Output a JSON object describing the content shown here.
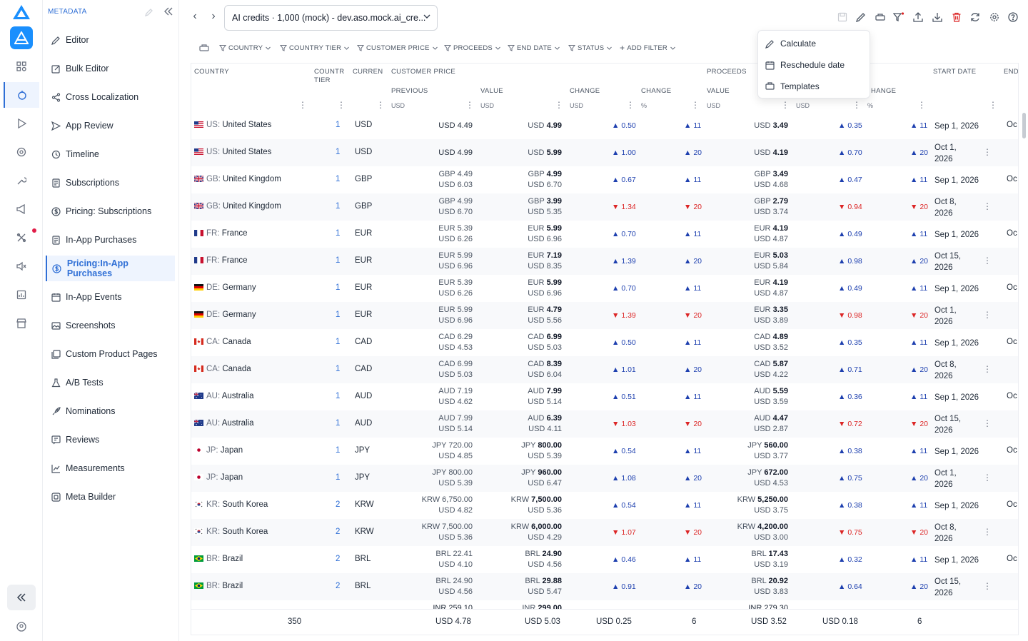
{
  "rail": {
    "items": [
      "apps-icon",
      "app-store-icon",
      "play-icon",
      "target-icon",
      "wrench-icon",
      "megaphone-icon",
      "tools-icon",
      "sound-icon",
      "report-icon",
      "store-icon"
    ]
  },
  "sidebar": {
    "header": "METADATA",
    "items": [
      {
        "label": "Editor",
        "icon": "pencil-icon"
      },
      {
        "label": "Bulk Editor",
        "icon": "edit-box-icon"
      },
      {
        "label": "Cross Localization",
        "icon": "share-icon"
      },
      {
        "label": "App Review",
        "icon": "send-icon"
      },
      {
        "label": "Timeline",
        "icon": "history-icon"
      },
      {
        "label": "Subscriptions",
        "icon": "document-icon"
      },
      {
        "label": "Pricing: Subscriptions",
        "icon": "dollar-icon"
      },
      {
        "label": "In-App Purchases",
        "icon": "document-icon"
      },
      {
        "label": "Pricing:In-App Purchases",
        "icon": "dollar-icon"
      },
      {
        "label": "In-App Events",
        "icon": "calendar-icon"
      },
      {
        "label": "Screenshots",
        "icon": "image-icon"
      },
      {
        "label": "Custom Product Pages",
        "icon": "pages-icon"
      },
      {
        "label": "A/B Tests",
        "icon": "flask-icon"
      },
      {
        "label": "Nominations",
        "icon": "rocket-icon"
      },
      {
        "label": "Reviews",
        "icon": "review-icon"
      },
      {
        "label": "Measurements",
        "icon": "chart-icon"
      },
      {
        "label": "Meta Builder",
        "icon": "layers-icon"
      }
    ],
    "active_index": 8
  },
  "topbar": {
    "selector_value": "AI credits · 1,000 (mock) - dev.aso.mock.ai_cre...",
    "tools": [
      "save-icon",
      "edit-icon",
      "transfer-icon",
      "filter-icon",
      "upload-icon",
      "download-icon",
      "delete-icon",
      "refresh-icon",
      "settings-icon",
      "help-icon"
    ]
  },
  "filters": [
    "COUNTRY",
    "COUNTRY TIER",
    "CUSTOMER PRICE",
    "PROCEEDS",
    "END DATE",
    "STATUS",
    "ADD FILTER"
  ],
  "menu": [
    {
      "label": "Calculate",
      "icon": "pencil-icon"
    },
    {
      "label": "Reschedule date",
      "icon": "calendar-icon"
    },
    {
      "label": "Templates",
      "icon": "template-icon"
    }
  ],
  "table": {
    "headers": {
      "country": "COUNTRY",
      "tier_1": "COUNTR",
      "tier_2": "TIER",
      "currency": "CURREN",
      "customer_price": "CUSTOMER PRICE",
      "previous": "PREVIOUS",
      "value": "VALUE",
      "change": "CHANGE",
      "change_pct": "CHANGE",
      "proceeds": "PROCEEDS",
      "proceeds_value": "VALUE",
      "proceeds_change": "HANGE",
      "start_date": "START DATE",
      "end_date": "END",
      "usd": "USD",
      "pct": "%"
    },
    "rows": [
      {
        "flag": "us",
        "code": "US:",
        "country": "United States",
        "tier": "1",
        "currency": "USD",
        "prev_local": "",
        "prev_usd": "USD 4.49",
        "val_cur": "USD",
        "val_num": "4.99",
        "val_usd": "",
        "change": "0.50",
        "change_pct": "11",
        "dir": "up",
        "proc_cur": "USD",
        "proc_num": "3.49",
        "proc_usd": "",
        "proc_change": "0.35",
        "proc_pct": "11",
        "start": "Sep 1, 2026",
        "end": "Oc"
      },
      {
        "flag": "us",
        "code": "US:",
        "country": "United States",
        "tier": "1",
        "currency": "USD",
        "prev_local": "",
        "prev_usd": "USD 4.99",
        "val_cur": "USD",
        "val_num": "5.99",
        "val_usd": "",
        "change": "1.00",
        "change_pct": "20",
        "dir": "up",
        "proc_cur": "USD",
        "proc_num": "4.19",
        "proc_usd": "",
        "proc_change": "0.70",
        "proc_pct": "20",
        "start": "Oct 1, 2026",
        "end": ""
      },
      {
        "flag": "gb",
        "code": "GB:",
        "country": "United Kingdom",
        "tier": "1",
        "currency": "GBP",
        "prev_local": "GBP 4.49",
        "prev_usd": "USD 6.03",
        "val_cur": "GBP",
        "val_num": "4.99",
        "val_usd": "USD 6.70",
        "change": "0.67",
        "change_pct": "11",
        "dir": "up",
        "proc_cur": "GBP",
        "proc_num": "3.49",
        "proc_usd": "USD 4.68",
        "proc_change": "0.47",
        "proc_pct": "11",
        "start": "Sep 1, 2026",
        "end": "Oc"
      },
      {
        "flag": "gb",
        "code": "GB:",
        "country": "United Kingdom",
        "tier": "1",
        "currency": "GBP",
        "prev_local": "GBP 4.99",
        "prev_usd": "USD 6.70",
        "val_cur": "GBP",
        "val_num": "3.99",
        "val_usd": "USD 5.35",
        "change": "1.34",
        "change_pct": "20",
        "dir": "down",
        "proc_cur": "GBP",
        "proc_num": "2.79",
        "proc_usd": "USD 3.74",
        "proc_change": "0.94",
        "proc_pct": "20",
        "start": "Oct 8, 2026",
        "end": ""
      },
      {
        "flag": "fr",
        "code": "FR:",
        "country": "France",
        "tier": "1",
        "currency": "EUR",
        "prev_local": "EUR 5.39",
        "prev_usd": "USD 6.26",
        "val_cur": "EUR",
        "val_num": "5.99",
        "val_usd": "USD 6.96",
        "change": "0.70",
        "change_pct": "11",
        "dir": "up",
        "proc_cur": "EUR",
        "proc_num": "4.19",
        "proc_usd": "USD 4.87",
        "proc_change": "0.49",
        "proc_pct": "11",
        "start": "Sep 1, 2026",
        "end": "Oc"
      },
      {
        "flag": "fr",
        "code": "FR:",
        "country": "France",
        "tier": "1",
        "currency": "EUR",
        "prev_local": "EUR 5.99",
        "prev_usd": "USD 6.96",
        "val_cur": "EUR",
        "val_num": "7.19",
        "val_usd": "USD 8.35",
        "change": "1.39",
        "change_pct": "20",
        "dir": "up",
        "proc_cur": "EUR",
        "proc_num": "5.03",
        "proc_usd": "USD 5.84",
        "proc_change": "0.98",
        "proc_pct": "20",
        "start": "Oct 15, 2026",
        "end": ""
      },
      {
        "flag": "de",
        "code": "DE:",
        "country": "Germany",
        "tier": "1",
        "currency": "EUR",
        "prev_local": "EUR 5.39",
        "prev_usd": "USD 6.26",
        "val_cur": "EUR",
        "val_num": "5.99",
        "val_usd": "USD 6.96",
        "change": "0.70",
        "change_pct": "11",
        "dir": "up",
        "proc_cur": "EUR",
        "proc_num": "4.19",
        "proc_usd": "USD 4.87",
        "proc_change": "0.49",
        "proc_pct": "11",
        "start": "Sep 1, 2026",
        "end": "Oc"
      },
      {
        "flag": "de",
        "code": "DE:",
        "country": "Germany",
        "tier": "1",
        "currency": "EUR",
        "prev_local": "EUR 5.99",
        "prev_usd": "USD 6.96",
        "val_cur": "EUR",
        "val_num": "4.79",
        "val_usd": "USD 5.56",
        "change": "1.39",
        "change_pct": "20",
        "dir": "down",
        "proc_cur": "EUR",
        "proc_num": "3.35",
        "proc_usd": "USD 3.89",
        "proc_change": "0.98",
        "proc_pct": "20",
        "start": "Oct 1, 2026",
        "end": ""
      },
      {
        "flag": "ca",
        "code": "CA:",
        "country": "Canada",
        "tier": "1",
        "currency": "CAD",
        "prev_local": "CAD 6.29",
        "prev_usd": "USD 4.53",
        "val_cur": "CAD",
        "val_num": "6.99",
        "val_usd": "USD 5.03",
        "change": "0.50",
        "change_pct": "11",
        "dir": "up",
        "proc_cur": "CAD",
        "proc_num": "4.89",
        "proc_usd": "USD 3.52",
        "proc_change": "0.35",
        "proc_pct": "11",
        "start": "Sep 1, 2026",
        "end": "Oc"
      },
      {
        "flag": "ca",
        "code": "CA:",
        "country": "Canada",
        "tier": "1",
        "currency": "CAD",
        "prev_local": "CAD 6.99",
        "prev_usd": "USD 5.03",
        "val_cur": "CAD",
        "val_num": "8.39",
        "val_usd": "USD 6.04",
        "change": "1.01",
        "change_pct": "20",
        "dir": "up",
        "proc_cur": "CAD",
        "proc_num": "5.87",
        "proc_usd": "USD 4.22",
        "proc_change": "0.71",
        "proc_pct": "20",
        "start": "Oct 8, 2026",
        "end": ""
      },
      {
        "flag": "au",
        "code": "AU:",
        "country": "Australia",
        "tier": "1",
        "currency": "AUD",
        "prev_local": "AUD 7.19",
        "prev_usd": "USD 4.62",
        "val_cur": "AUD",
        "val_num": "7.99",
        "val_usd": "USD 5.14",
        "change": "0.51",
        "change_pct": "11",
        "dir": "up",
        "proc_cur": "AUD",
        "proc_num": "5.59",
        "proc_usd": "USD 3.59",
        "proc_change": "0.36",
        "proc_pct": "11",
        "start": "Sep 1, 2026",
        "end": "Oc"
      },
      {
        "flag": "au",
        "code": "AU:",
        "country": "Australia",
        "tier": "1",
        "currency": "AUD",
        "prev_local": "AUD 7.99",
        "prev_usd": "USD 5.14",
        "val_cur": "AUD",
        "val_num": "6.39",
        "val_usd": "USD 4.11",
        "change": "1.03",
        "change_pct": "20",
        "dir": "down",
        "proc_cur": "AUD",
        "proc_num": "4.47",
        "proc_usd": "USD 2.87",
        "proc_change": "0.72",
        "proc_pct": "20",
        "start": "Oct 15, 2026",
        "end": ""
      },
      {
        "flag": "jp",
        "code": "JP:",
        "country": "Japan",
        "tier": "1",
        "currency": "JPY",
        "prev_local": "JPY 720.00",
        "prev_usd": "USD 4.85",
        "val_cur": "JPY",
        "val_num": "800.00",
        "val_usd": "USD 5.39",
        "change": "0.54",
        "change_pct": "11",
        "dir": "up",
        "proc_cur": "JPY",
        "proc_num": "560.00",
        "proc_usd": "USD 3.77",
        "proc_change": "0.38",
        "proc_pct": "11",
        "start": "Sep 1, 2026",
        "end": "Oc"
      },
      {
        "flag": "jp",
        "code": "JP:",
        "country": "Japan",
        "tier": "1",
        "currency": "JPY",
        "prev_local": "JPY 800.00",
        "prev_usd": "USD 5.39",
        "val_cur": "JPY",
        "val_num": "960.00",
        "val_usd": "USD 6.47",
        "change": "1.08",
        "change_pct": "20",
        "dir": "up",
        "proc_cur": "JPY",
        "proc_num": "672.00",
        "proc_usd": "USD 4.53",
        "proc_change": "0.75",
        "proc_pct": "20",
        "start": "Oct 1, 2026",
        "end": ""
      },
      {
        "flag": "kr",
        "code": "KR:",
        "country": "South Korea",
        "tier": "2",
        "currency": "KRW",
        "prev_local": "KRW 6,750.00",
        "prev_usd": "USD 4.82",
        "val_cur": "KRW",
        "val_num": "7,500.00",
        "val_usd": "USD 5.36",
        "change": "0.54",
        "change_pct": "11",
        "dir": "up",
        "proc_cur": "KRW",
        "proc_num": "5,250.00",
        "proc_usd": "USD 3.75",
        "proc_change": "0.38",
        "proc_pct": "11",
        "start": "Sep 1, 2026",
        "end": "Oc"
      },
      {
        "flag": "kr",
        "code": "KR:",
        "country": "South Korea",
        "tier": "2",
        "currency": "KRW",
        "prev_local": "KRW 7,500.00",
        "prev_usd": "USD 5.36",
        "val_cur": "KRW",
        "val_num": "6,000.00",
        "val_usd": "USD 4.29",
        "change": "1.07",
        "change_pct": "20",
        "dir": "down",
        "proc_cur": "KRW",
        "proc_num": "4,200.00",
        "proc_usd": "USD 3.00",
        "proc_change": "0.75",
        "proc_pct": "20",
        "start": "Oct 8, 2026",
        "end": ""
      },
      {
        "flag": "br",
        "code": "BR:",
        "country": "Brazil",
        "tier": "2",
        "currency": "BRL",
        "prev_local": "BRL 22.41",
        "prev_usd": "USD 4.10",
        "val_cur": "BRL",
        "val_num": "24.90",
        "val_usd": "USD 4.56",
        "change": "0.46",
        "change_pct": "11",
        "dir": "up",
        "proc_cur": "BRL",
        "proc_num": "17.43",
        "proc_usd": "USD 3.19",
        "proc_change": "0.32",
        "proc_pct": "11",
        "start": "Sep 1, 2026",
        "end": "Oc"
      },
      {
        "flag": "br",
        "code": "BR:",
        "country": "Brazil",
        "tier": "2",
        "currency": "BRL",
        "prev_local": "BRL 24.90",
        "prev_usd": "USD 4.56",
        "val_cur": "BRL",
        "val_num": "29.88",
        "val_usd": "USD 5.47",
        "change": "0.91",
        "change_pct": "20",
        "dir": "up",
        "proc_cur": "BRL",
        "proc_num": "20.92",
        "proc_usd": "USD 3.83",
        "proc_change": "0.64",
        "proc_pct": "20",
        "start": "Oct 15, 2026",
        "end": ""
      }
    ],
    "partial_row": {
      "prev_local": "INR 259.10",
      "val_cur": "INR",
      "val_num": "299.00",
      "proc_local": "INR 279.30"
    },
    "footer": {
      "count": "350",
      "prev_avg": "USD 4.78",
      "val_avg": "USD 5.03",
      "change_avg": "USD 0.25",
      "change_pct_avg": "6",
      "proc_avg": "USD 3.52",
      "proc_change_avg": "USD 0.18",
      "proc_pct_avg": "6"
    }
  },
  "colors": {
    "accent": "#2f6fd6",
    "up": "#1e40af",
    "down": "#dc2626",
    "delete": "#dc2626"
  }
}
